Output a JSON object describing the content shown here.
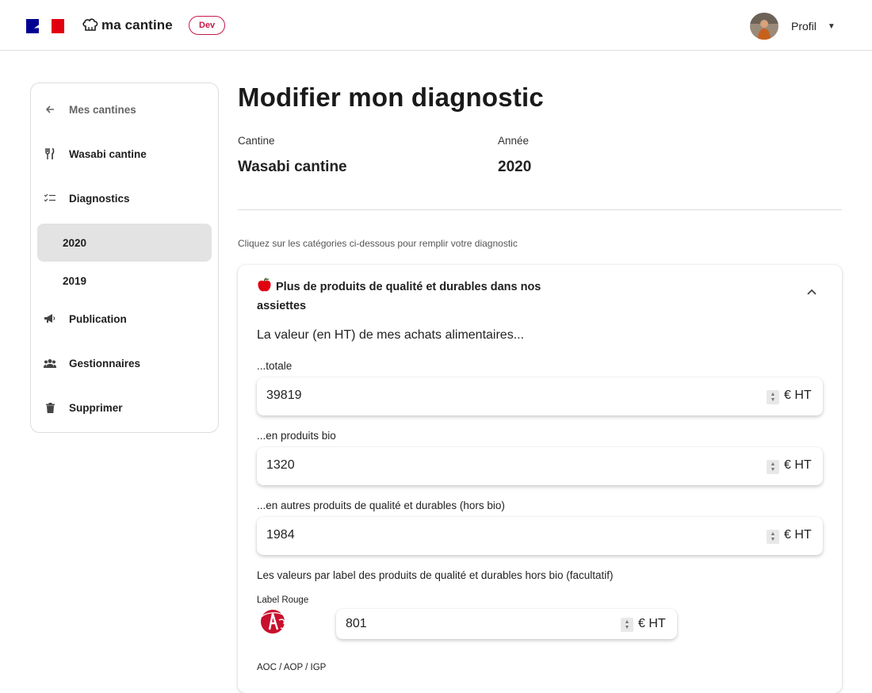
{
  "header": {
    "logo_text": "ma cantine",
    "env_badge": "Dev",
    "profile_label": "Profil"
  },
  "sidebar": {
    "items": [
      {
        "label": "Mes cantines",
        "icon": "arrow-left-icon"
      },
      {
        "label": "Wasabi cantine",
        "icon": "fork-knife-icon"
      },
      {
        "label": "Diagnostics",
        "icon": "checklist-icon"
      },
      {
        "label": "2020",
        "icon": "",
        "active": true
      },
      {
        "label": "2019",
        "icon": ""
      },
      {
        "label": "Publication",
        "icon": "megaphone-icon"
      },
      {
        "label": "Gestionnaires",
        "icon": "group-icon"
      },
      {
        "label": "Supprimer",
        "icon": "trash-icon"
      }
    ]
  },
  "main": {
    "title": "Modifier mon diagnostic",
    "canteen_label": "Cantine",
    "canteen_value": "Wasabi cantine",
    "year_label": "Année",
    "year_value": "2020",
    "hint": "Cliquez sur les catégories ci-dessous pour remplir votre diagnostic"
  },
  "card": {
    "heading": "Plus de produits de qualité et durables dans nos assiettes",
    "lead": "La valeur (en HT) de mes achats alimentaires...",
    "fields": [
      {
        "label": "...totale",
        "value": "39819",
        "unit": "€ HT"
      },
      {
        "label": "...en produits bio",
        "value": "1320",
        "unit": "€ HT"
      },
      {
        "label": "...en autres produits de qualité et durables (hors bio)",
        "value": "1984",
        "unit": "€ HT"
      }
    ],
    "labels_intro": "Les valeurs par label des produits de qualité et durables hors bio (facultatif)",
    "label_rouge": {
      "label": "Label Rouge",
      "value": "801",
      "unit": "€ HT"
    },
    "next_label": "AOC / AOP / IGP"
  },
  "colors": {
    "badge": "#c9184a",
    "active_nav": "#e3e3e3",
    "flag_blue": "#000091",
    "flag_red": "#e1000f"
  }
}
